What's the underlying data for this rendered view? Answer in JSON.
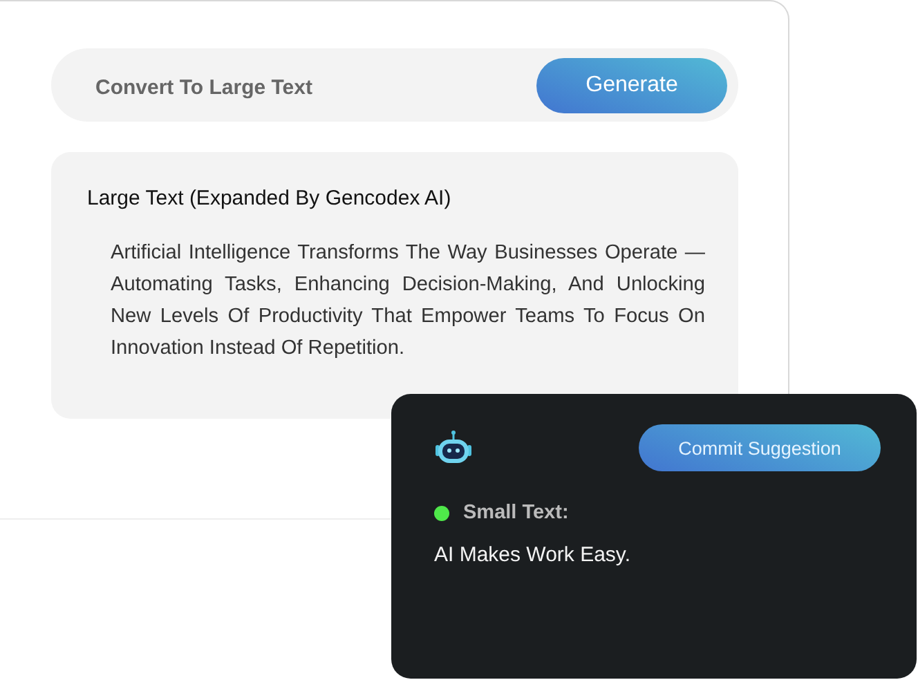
{
  "prompt": {
    "text": "Convert To Large Text",
    "button": "Generate"
  },
  "large_text": {
    "title": "Large Text (Expanded By Gencodex AI)",
    "body": "Artificial Intelligence Transforms The Way Businesses Operate — Automating Tasks, Enhancing Decision-Making, And Unlocking New Levels Of Productivity That Empower Teams To Focus On Innovation Instead Of Repetition."
  },
  "suggestion": {
    "button": "Commit Suggestion",
    "label": "Small Text:",
    "text": "AI Makes Work Easy."
  }
}
